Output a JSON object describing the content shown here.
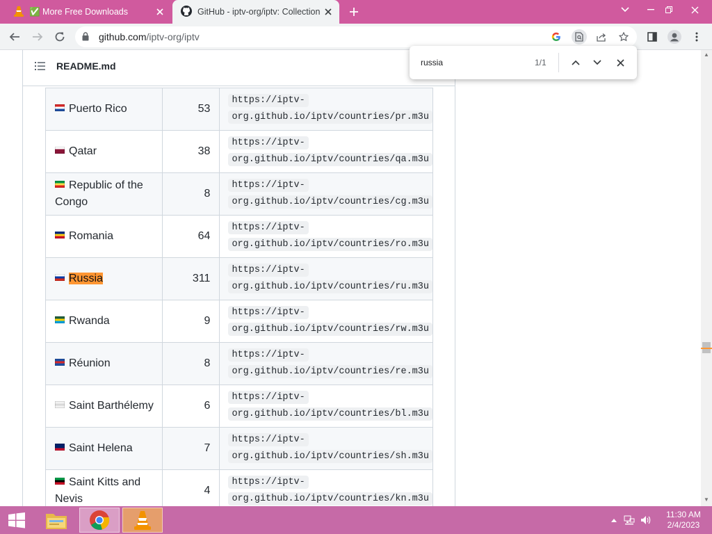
{
  "browser": {
    "tabs": [
      {
        "title": "✅ More Free Downloads",
        "active": false,
        "icon": "vlc-cone-icon"
      },
      {
        "title": "GitHub - iptv-org/iptv: Collection of",
        "active": true,
        "icon": "github-icon"
      }
    ],
    "url_host": "github.com",
    "url_path": "/iptv-org/iptv"
  },
  "readme": {
    "filename": "README.md"
  },
  "table": {
    "rows": [
      {
        "country": "Puerto Rico",
        "count": "53",
        "url1": "https://iptv-",
        "url2": "org.github.io/iptv/countries/pr.m3u",
        "flag": [
          "#d62828",
          "#ffffff",
          "#1f4fa3"
        ]
      },
      {
        "country": "Qatar",
        "count": "38",
        "url1": "https://iptv-",
        "url2": "org.github.io/iptv/countries/qa.m3u",
        "flag": [
          "#ffffff",
          "#8a1538",
          "#8a1538"
        ]
      },
      {
        "country": "Republic of the Congo",
        "count": "8",
        "url1": "https://iptv-",
        "url2": "org.github.io/iptv/countries/cg.m3u",
        "flag": [
          "#009543",
          "#fbde4a",
          "#dc241f"
        ]
      },
      {
        "country": "Romania",
        "count": "64",
        "url1": "https://iptv-",
        "url2": "org.github.io/iptv/countries/ro.m3u",
        "flag": [
          "#002b7f",
          "#fcd116",
          "#ce1126"
        ]
      },
      {
        "country": "Russia",
        "count": "311",
        "url1": "https://iptv-",
        "url2": "org.github.io/iptv/countries/ru.m3u",
        "flag": [
          "#ffffff",
          "#0039a6",
          "#d52b1e"
        ],
        "highlight": true
      },
      {
        "country": "Rwanda",
        "count": "9",
        "url1": "https://iptv-",
        "url2": "org.github.io/iptv/countries/rw.m3u",
        "flag": [
          "#20603d",
          "#fad201",
          "#00a1de"
        ]
      },
      {
        "country": "Réunion",
        "count": "8",
        "url1": "https://iptv-",
        "url2": "org.github.io/iptv/countries/re.m3u",
        "flag": [
          "#1f4fa3",
          "#d62828",
          "#1f4fa3"
        ]
      },
      {
        "country": "Saint Barthélemy",
        "count": "6",
        "url1": "https://iptv-",
        "url2": "org.github.io/iptv/countries/bl.m3u",
        "flag": [
          "#f2f2f2",
          "#d9d9d9",
          "#f2f2f2"
        ]
      },
      {
        "country": "Saint Helena",
        "count": "7",
        "url1": "https://iptv-",
        "url2": "org.github.io/iptv/countries/sh.m3u",
        "flag": [
          "#012169",
          "#012169",
          "#c8102e"
        ]
      },
      {
        "country": "Saint Kitts and Nevis",
        "count": "4",
        "url1": "https://iptv-",
        "url2": "org.github.io/iptv/countries/kn.m3u",
        "flag": [
          "#009e49",
          "#000000",
          "#ce1126"
        ]
      }
    ]
  },
  "find": {
    "query": "russia",
    "count": "1/1"
  },
  "taskbar": {
    "time": "11:30 AM",
    "date": "2/4/2023"
  },
  "colors": {
    "tabstrip": "#d05a9e",
    "taskbar": "#c66aa7",
    "find_highlight": "#ff9632"
  }
}
